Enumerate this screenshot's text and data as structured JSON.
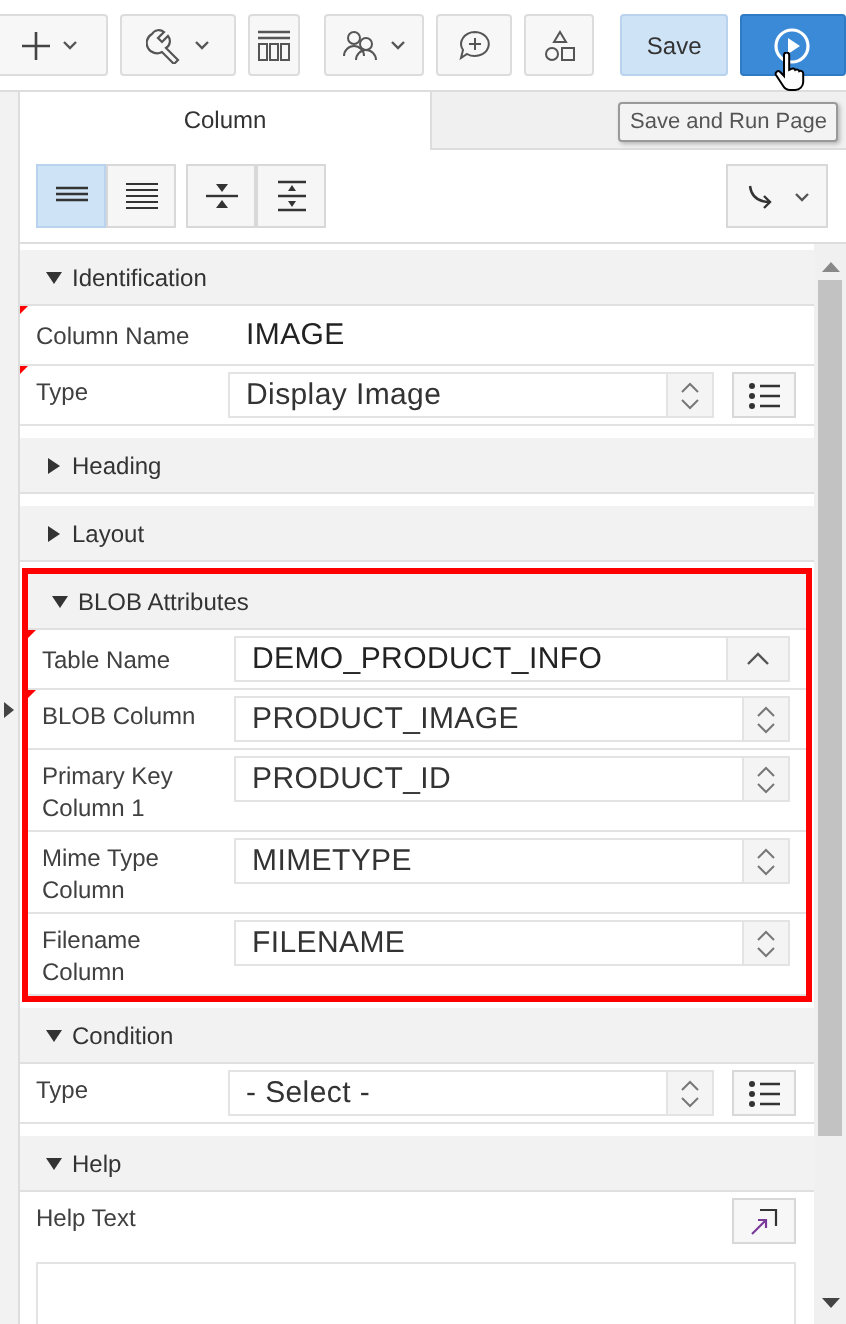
{
  "toolbar": {
    "save_button": "Save",
    "run_button": {
      "hovered": true
    },
    "tooltip": "Save and Run Page"
  },
  "tabs": [
    {
      "label": "Column",
      "selected": true
    },
    {
      "selected": false
    }
  ],
  "view_toggle": [
    {
      "selected": true
    },
    {
      "selected": false
    }
  ],
  "sections": [
    {
      "title": "Identification",
      "expanded": true,
      "highlighted": false,
      "fields": [
        {
          "label": "Column Name",
          "kind": "text",
          "value": "IMAGE",
          "required": true
        },
        {
          "label": "Type",
          "kind": "select",
          "value": "Display Image",
          "required": true,
          "list_button": true
        }
      ]
    },
    {
      "title": "Heading",
      "expanded": false,
      "highlighted": false
    },
    {
      "title": "Layout",
      "expanded": false,
      "highlighted": false
    },
    {
      "title": "BLOB Attributes",
      "expanded": true,
      "highlighted": true,
      "fields": [
        {
          "label": "Table Name",
          "kind": "lov",
          "value": "DEMO_PRODUCT_INFO",
          "required": true
        },
        {
          "label": "BLOB Column",
          "kind": "select",
          "value": "PRODUCT_IMAGE",
          "required": true
        },
        {
          "label": "Primary Key Column 1",
          "kind": "select",
          "value": "PRODUCT_ID",
          "required": false
        },
        {
          "label": "Mime Type Column",
          "kind": "select",
          "value": "MIMETYPE",
          "required": false
        },
        {
          "label": "Filename Column",
          "kind": "select",
          "value": "FILENAME",
          "required": false
        }
      ]
    },
    {
      "title": "Condition",
      "expanded": true,
      "highlighted": false,
      "fields": [
        {
          "label": "Type",
          "kind": "select",
          "value": "- Select -",
          "required": false,
          "list_button": true
        }
      ]
    },
    {
      "title": "Help",
      "expanded": true,
      "highlighted": false,
      "fields": [
        {
          "label": "Help Text",
          "kind": "textarea",
          "required": false
        }
      ]
    }
  ]
}
